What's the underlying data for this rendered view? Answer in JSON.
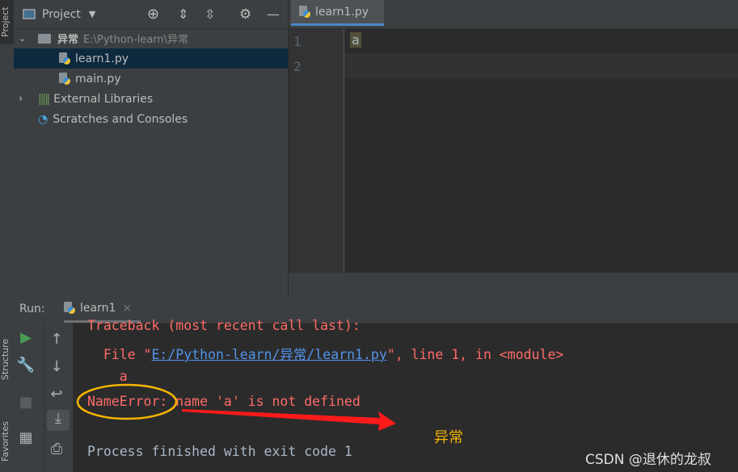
{
  "tool_strip": {
    "project_tab": "Project",
    "structure_tab": "Structure",
    "favorites_tab": "Favorites"
  },
  "project_panel": {
    "title": "Project",
    "tree": [
      {
        "label": "异常",
        "path": "E:\\Python-learn\\异常"
      },
      {
        "label": "learn1.py"
      },
      {
        "label": "main.py"
      },
      {
        "label": "External Libraries"
      },
      {
        "label": "Scratches and Consoles"
      }
    ]
  },
  "editor": {
    "tab": "learn1.py",
    "line_numbers": [
      "1",
      "2"
    ],
    "lines": [
      "a",
      ""
    ]
  },
  "run": {
    "label": "Run:",
    "tab": "learn1",
    "console": {
      "traceback": "Traceback (most recent call last):",
      "file_prefix": "  File \"",
      "file_link": "E:/Python-learn/异常/learn1.py",
      "file_suffix": "\", line 1, in <module>",
      "code": "    a",
      "error_type": "NameError:",
      "error_msg": " name 'a' is not defined",
      "finished": "Process finished with exit code 1"
    }
  },
  "annotation": {
    "label": "异常",
    "ellipse_color": "#f5b400",
    "arrow_color": "#ff1a1a"
  },
  "watermark": "CSDN @退休的龙叔"
}
